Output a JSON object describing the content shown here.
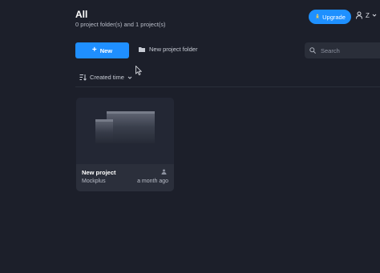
{
  "header": {
    "title": "All",
    "subtitle": "0 project folder(s) and 1 project(s)",
    "upgrade_label": "Upgrade",
    "user_initial": "Z"
  },
  "toolbar": {
    "new_label": "New",
    "new_folder_label": "New project folder",
    "search_placeholder": "Search"
  },
  "sort": {
    "label": "Created time"
  },
  "projects": [
    {
      "name": "New project",
      "owner": "Mockplus",
      "time": "a month ago"
    }
  ],
  "colors": {
    "background": "#1c1f2a",
    "accent": "#1f8fff",
    "card": "#252935"
  },
  "icons": {
    "upgrade": "rocket-icon",
    "user": "person-icon",
    "folder": "folder-icon",
    "search": "search-icon",
    "sort": "sort-icon",
    "shared": "person-icon"
  }
}
